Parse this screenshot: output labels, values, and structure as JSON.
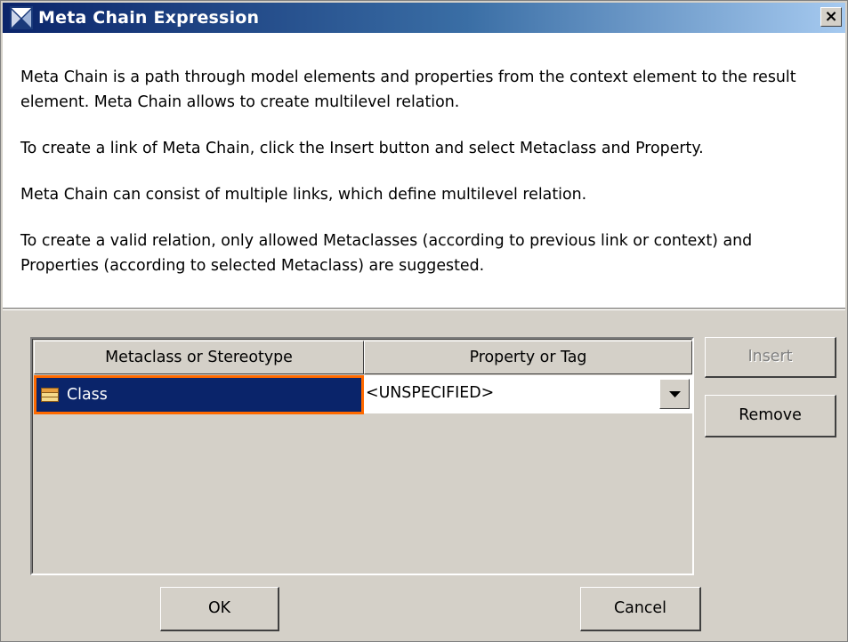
{
  "dialog": {
    "title": "Meta Chain Expression",
    "close_label": "×"
  },
  "description": {
    "paragraphs": [
      "Meta Chain is a path through model elements and properties from the context element to the result element. Meta Chain allows to create multilevel relation.",
      "To create a link of Meta Chain, click the Insert button and select Metaclass and Property.",
      "Meta Chain can consist of multiple links, which define multilevel relation.",
      "To create a valid relation, only allowed Metaclasses (according to previous link or context) and Properties (according to selected Metaclass) are suggested."
    ]
  },
  "table": {
    "columns": [
      "Metaclass or Stereotype",
      "Property or Tag"
    ],
    "rows": [
      {
        "metaclass": "Class",
        "metaclass_icon": "class-icon",
        "property": "<UNSPECIFIED>"
      }
    ]
  },
  "side_buttons": {
    "insert_label": "Insert",
    "insert_enabled": false,
    "remove_label": "Remove"
  },
  "footer": {
    "ok_label": "OK",
    "cancel_label": "Cancel"
  },
  "colors": {
    "selection": "#0a246a",
    "selection_border": "#ff6a00",
    "dialog_bg": "#d4d0c8"
  }
}
